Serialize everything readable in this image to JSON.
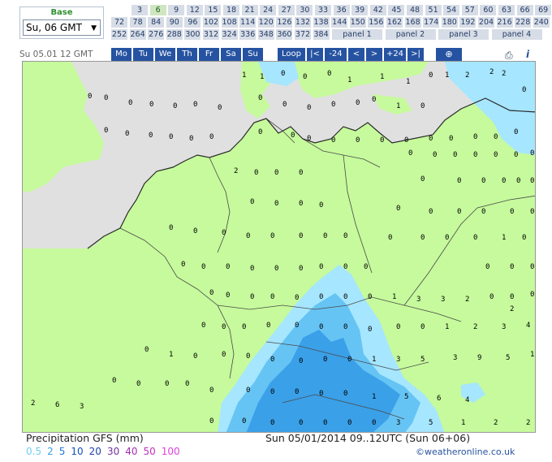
{
  "base": {
    "label": "Base",
    "selected": "Su, 06 GMT"
  },
  "hours_row1": [
    "3",
    "6",
    "9",
    "12",
    "15",
    "18",
    "21",
    "24",
    "27",
    "30",
    "33",
    "36",
    "39",
    "42",
    "45",
    "48",
    "51",
    "54",
    "57",
    "60",
    "63",
    "66",
    "69"
  ],
  "hours_row2": [
    "72",
    "78",
    "84",
    "90",
    "96",
    "102",
    "108",
    "114",
    "120",
    "126",
    "132",
    "138",
    "144",
    "150",
    "156",
    "162",
    "168",
    "174",
    "180",
    "192",
    "204",
    "216",
    "228",
    "240"
  ],
  "hours_row3": [
    "252",
    "264",
    "276",
    "288",
    "300",
    "312",
    "324",
    "336",
    "348",
    "360",
    "372",
    "384"
  ],
  "panels": [
    "panel 1",
    "panel 2",
    "panel 3",
    "panel 4"
  ],
  "active_hour": "6",
  "date_label": "Su 05.01 12 GMT",
  "days": [
    "Mo",
    "Tu",
    "We",
    "Th",
    "Fr",
    "Sa",
    "Su"
  ],
  "nav_controls": [
    "Loop",
    "|<",
    "-24",
    "<",
    ">",
    "+24",
    ">|"
  ],
  "zoom_icon": "magnifier-plus-icon",
  "print_icon": "printer-icon",
  "info_icon": "i",
  "legend": {
    "title": "Precipitation GFS (mm)",
    "scale": [
      {
        "value": "0.5",
        "color": "#6ecff6"
      },
      {
        "value": "2",
        "color": "#3aa0e8"
      },
      {
        "value": "5",
        "color": "#1e78d8"
      },
      {
        "value": "10",
        "color": "#1450c0"
      },
      {
        "value": "20",
        "color": "#2040a8"
      },
      {
        "value": "30",
        "color": "#7030a0"
      },
      {
        "value": "40",
        "color": "#a030b0"
      },
      {
        "value": "50",
        "color": "#c030c0"
      },
      {
        "value": "100",
        "color": "#e040e0"
      }
    ]
  },
  "run_time": "Sun 05/01/2014 09..12UTC   (Sun 06+06)",
  "credit": "©weatheronline.co.uk",
  "colors": {
    "land": "#c6fa9c",
    "sea": "#e0e0e0",
    "rain_light": "#a6e6ff",
    "rain_mid": "#66c4f4",
    "rain_heavy": "#3aa0e8",
    "nav_blue": "#2653a1"
  },
  "map_values": [
    {
      "v": "1"
    },
    {
      "v": "1"
    },
    {
      "v": "0"
    },
    {
      "v": "0"
    },
    {
      "v": "0"
    },
    {
      "v": "1"
    },
    {
      "v": "1"
    },
    {
      "v": "1"
    },
    {
      "v": "0"
    },
    {
      "v": "1"
    },
    {
      "v": "2"
    },
    {
      "v": "2"
    },
    {
      "v": "2"
    },
    {
      "v": "0"
    },
    {
      "v": "0"
    },
    {
      "v": "0"
    },
    {
      "v": "0"
    },
    {
      "v": "0"
    },
    {
      "v": "0"
    },
    {
      "v": "0"
    },
    {
      "v": "0"
    },
    {
      "v": "0"
    },
    {
      "v": "0"
    },
    {
      "v": "0"
    },
    {
      "v": "0"
    },
    {
      "v": "0"
    },
    {
      "v": "1"
    },
    {
      "v": "0"
    },
    {
      "v": "0"
    },
    {
      "v": "0"
    },
    {
      "v": "0"
    },
    {
      "v": "0"
    },
    {
      "v": "0"
    },
    {
      "v": "0"
    },
    {
      "v": "0"
    },
    {
      "v": "0"
    },
    {
      "v": "0"
    },
    {
      "v": "0"
    },
    {
      "v": "0"
    },
    {
      "v": "0"
    },
    {
      "v": "0"
    },
    {
      "v": "0"
    },
    {
      "v": "0"
    },
    {
      "v": "0"
    },
    {
      "v": "0"
    },
    {
      "v": "0"
    },
    {
      "v": "2"
    },
    {
      "v": "0"
    },
    {
      "v": "0"
    },
    {
      "v": "0"
    },
    {
      "v": "0"
    },
    {
      "v": "0"
    },
    {
      "v": "0"
    },
    {
      "v": "0"
    },
    {
      "v": "0"
    },
    {
      "v": "0"
    },
    {
      "v": "0"
    },
    {
      "v": "0"
    },
    {
      "v": "0"
    },
    {
      "v": "0"
    },
    {
      "v": "0"
    },
    {
      "v": "0"
    },
    {
      "v": "0"
    },
    {
      "v": "0"
    },
    {
      "v": "0"
    },
    {
      "v": "0"
    },
    {
      "v": "0"
    },
    {
      "v": "0"
    },
    {
      "v": "0"
    },
    {
      "v": "0"
    },
    {
      "v": "0"
    },
    {
      "v": "0"
    },
    {
      "v": "0"
    },
    {
      "v": "0"
    },
    {
      "v": "0"
    },
    {
      "v": "0"
    },
    {
      "v": "0"
    },
    {
      "v": "0"
    },
    {
      "v": "0"
    },
    {
      "v": "0"
    },
    {
      "v": "0"
    },
    {
      "v": "0"
    },
    {
      "v": "0"
    },
    {
      "v": "0"
    },
    {
      "v": "0"
    },
    {
      "v": "0"
    },
    {
      "v": "0"
    },
    {
      "v": "0"
    },
    {
      "v": "0"
    },
    {
      "v": "0"
    },
    {
      "v": "0"
    },
    {
      "v": "0"
    },
    {
      "v": "0"
    },
    {
      "v": "0"
    },
    {
      "v": "0"
    },
    {
      "v": "1"
    },
    {
      "v": "0"
    },
    {
      "v": "0"
    },
    {
      "v": "0"
    },
    {
      "v": "0"
    },
    {
      "v": "0"
    },
    {
      "v": "0"
    },
    {
      "v": "0"
    },
    {
      "v": "0"
    },
    {
      "v": "0"
    },
    {
      "v": "0"
    },
    {
      "v": "0"
    },
    {
      "v": "0"
    },
    {
      "v": "1"
    },
    {
      "v": "3"
    },
    {
      "v": "3"
    },
    {
      "v": "2"
    },
    {
      "v": "0"
    },
    {
      "v": "0"
    },
    {
      "v": "0"
    },
    {
      "v": "0"
    },
    {
      "v": "0"
    },
    {
      "v": "0"
    },
    {
      "v": "0"
    },
    {
      "v": "0"
    },
    {
      "v": "0"
    },
    {
      "v": "0"
    },
    {
      "v": "0"
    },
    {
      "v": "0"
    },
    {
      "v": "0"
    },
    {
      "v": "1"
    },
    {
      "v": "2"
    },
    {
      "v": "3"
    },
    {
      "v": "4"
    },
    {
      "v": "2"
    },
    {
      "v": "0"
    },
    {
      "v": "1"
    },
    {
      "v": "0"
    },
    {
      "v": "0"
    },
    {
      "v": "0"
    },
    {
      "v": "0"
    },
    {
      "v": "0"
    },
    {
      "v": "0"
    },
    {
      "v": "0"
    },
    {
      "v": "1"
    },
    {
      "v": "3"
    },
    {
      "v": "5"
    },
    {
      "v": "3"
    },
    {
      "v": "9"
    },
    {
      "v": "5"
    },
    {
      "v": "1"
    },
    {
      "v": "0"
    },
    {
      "v": "0"
    },
    {
      "v": "0"
    },
    {
      "v": "0"
    },
    {
      "v": "0"
    },
    {
      "v": "0"
    },
    {
      "v": "0"
    },
    {
      "v": "0"
    },
    {
      "v": "0"
    },
    {
      "v": "0"
    },
    {
      "v": "1"
    },
    {
      "v": "5"
    },
    {
      "v": "6"
    },
    {
      "v": "4"
    },
    {
      "v": "2"
    },
    {
      "v": "6"
    },
    {
      "v": "3"
    },
    {
      "v": "0"
    },
    {
      "v": "0"
    },
    {
      "v": "0"
    },
    {
      "v": "0"
    },
    {
      "v": "0"
    },
    {
      "v": "0"
    },
    {
      "v": "0"
    },
    {
      "v": "3"
    },
    {
      "v": "5"
    },
    {
      "v": "1"
    },
    {
      "v": "2"
    },
    {
      "v": "2"
    },
    {
      "v": "2"
    },
    {
      "v": "2"
    },
    {
      "v": "1"
    },
    {
      "v": "0"
    },
    {
      "v": "0"
    },
    {
      "v": "0"
    }
  ]
}
